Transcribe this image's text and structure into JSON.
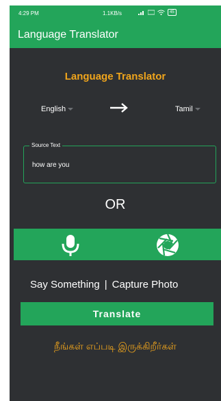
{
  "status_bar": {
    "time": "4:29 PM",
    "network_speed": "1.1KB/s",
    "icons": [
      "signal-icon",
      "volte-icon",
      "wifi-icon",
      "battery-icon"
    ],
    "battery_level": "45"
  },
  "app_bar": {
    "title": "Language Translator"
  },
  "main": {
    "heading": "Language Translator",
    "source_language": "English",
    "target_language": "Tamil",
    "arrow_icon": "arrow-right-icon",
    "source_field": {
      "label": "Source Text",
      "value": "how are you"
    },
    "or_label": "OR",
    "actions": {
      "mic_icon": "microphone-icon",
      "camera_icon": "camera-shutter-icon",
      "say_label": "Say Something",
      "separator": "|",
      "capture_label": "Capture Photo"
    },
    "translate_label": "Translate",
    "result_text": "நீங்கள் எப்படி இருக்கிறீர்கள்"
  },
  "colors": {
    "accent": "#23a55a",
    "highlight": "#f0a51c",
    "background": "#2e3033"
  }
}
